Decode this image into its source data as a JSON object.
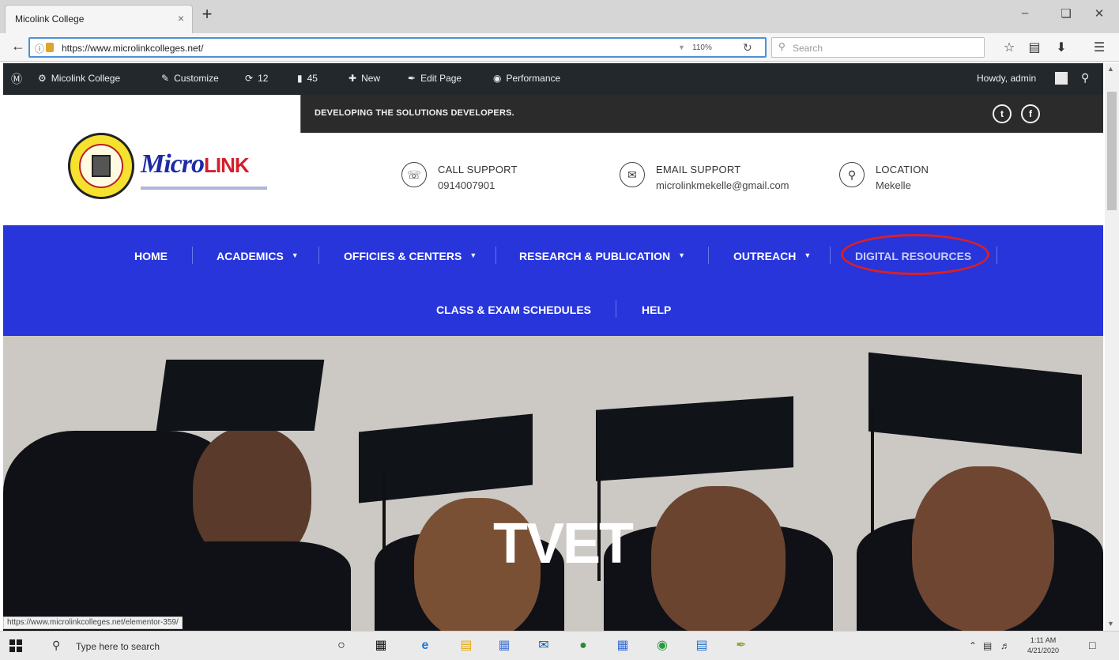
{
  "browser": {
    "tab_title": "Micolink College",
    "tab_close_glyph": "×",
    "new_tab_glyph": "+",
    "url": "https://www.microlinkcolleges.net/",
    "zoom": "110%",
    "search_placeholder": "Search",
    "status_url": "https://www.microlinkcolleges.net/elementor-359/"
  },
  "admin_bar": {
    "site_name": "Micolink College",
    "customize": "Customize",
    "updates_count": "12",
    "comments_count": "45",
    "new_label": "New",
    "edit_page": "Edit Page",
    "performance": "Performance",
    "howdy": "Howdy, admin"
  },
  "site": {
    "tagline": "DEVELOPING THE SOLUTIONS DEVELOPERS.",
    "logo_text_a": "Micro",
    "logo_text_b": "LINK",
    "contacts": [
      {
        "title": "CALL SUPPORT",
        "value": "0914007901"
      },
      {
        "title": "EMAIL SUPPORT",
        "value": "microlinkmekelle@gmail.com"
      },
      {
        "title": "LOCATION",
        "value": "Mekelle"
      }
    ],
    "nav": [
      {
        "label": "HOME"
      },
      {
        "label": "ACADEMICS"
      },
      {
        "label": "OFFICIES & CENTERS"
      },
      {
        "label": "RESEARCH & PUBLICATION"
      },
      {
        "label": "OUTREACH"
      },
      {
        "label": "DIGITAL RESOURCES"
      },
      {
        "label": "CLASS & EXAM SCHEDULES"
      },
      {
        "label": "HELP"
      }
    ],
    "hero_title": "TVET"
  },
  "taskbar": {
    "search_text": "Type here to search",
    "time": "1:11 AM",
    "date": "4/21/2020"
  },
  "colors": {
    "nav_bg": "#2735db",
    "admin_bar_bg": "#23282d",
    "highlight_ring": "#d92027"
  },
  "icons": [
    "wordpress-icon",
    "dashboard-icon",
    "brush-icon",
    "refresh-icon",
    "comment-icon",
    "plus-icon",
    "pencil-icon",
    "performance-icon",
    "phone-icon",
    "mail-icon",
    "location-pin-icon",
    "twitter-icon",
    "facebook-icon"
  ]
}
